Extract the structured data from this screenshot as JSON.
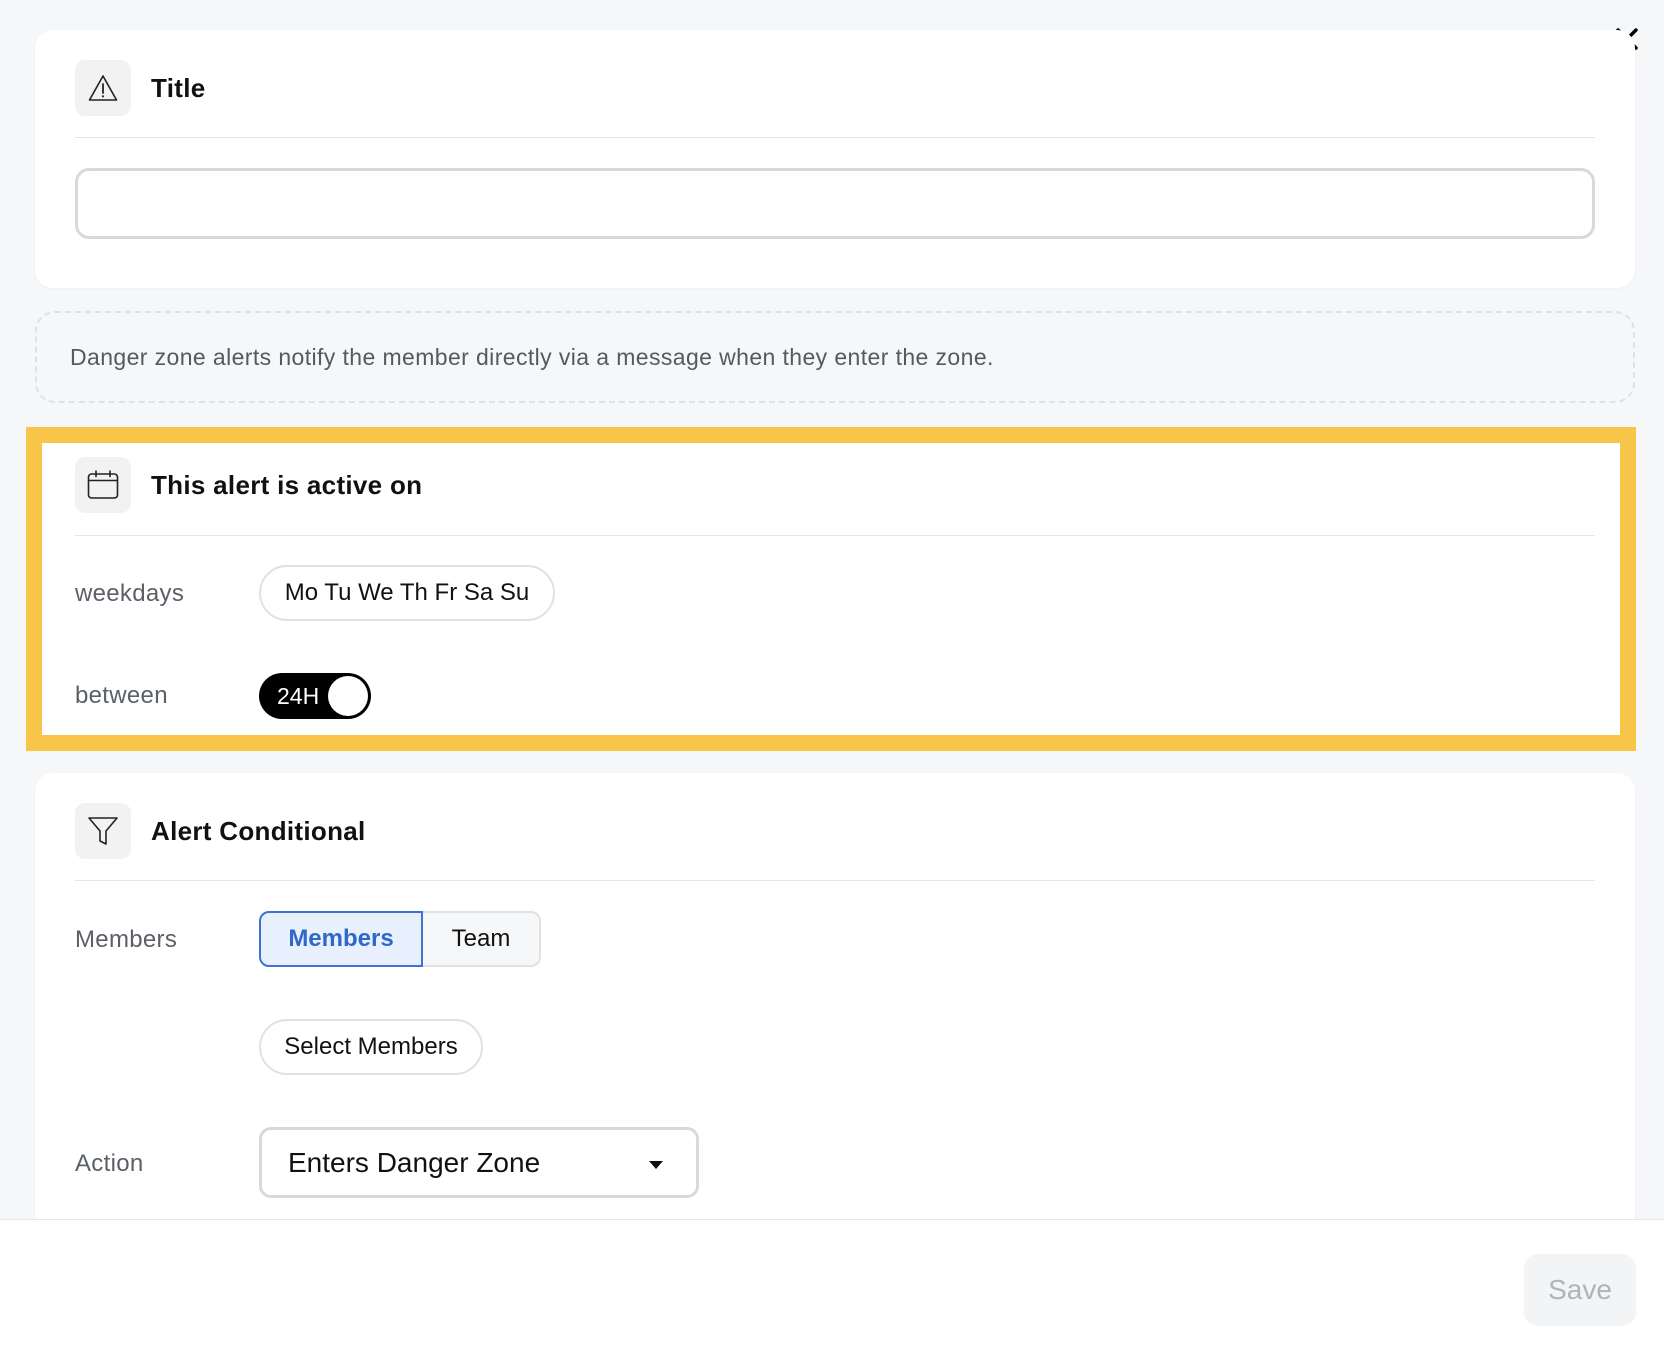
{
  "title_section": {
    "heading": "Title",
    "icon": "warning-icon",
    "input_value": ""
  },
  "info": {
    "text": "Danger zone alerts notify the member directly via a message when they enter the zone."
  },
  "schedule_section": {
    "heading": "This alert is active on",
    "icon": "calendar-icon",
    "highlight_color": "#f7c548",
    "weekdays_label": "weekdays",
    "weekdays_value": "Mo Tu We Th Fr Sa Su",
    "between_label": "between",
    "toggle_label": "24H",
    "toggle_on": true
  },
  "conditional_section": {
    "heading": "Alert Conditional",
    "icon": "filter-icon",
    "members_label": "Members",
    "segments": [
      "Members",
      "Team"
    ],
    "selected_segment": "Members",
    "select_members_label": "Select Members",
    "action_label": "Action",
    "action_value": "Enters Danger Zone"
  },
  "footer": {
    "save_label": "Save"
  },
  "colors": {
    "accent": "#3b73d4",
    "highlight": "#f7c548",
    "toggle_bg": "#000000"
  }
}
